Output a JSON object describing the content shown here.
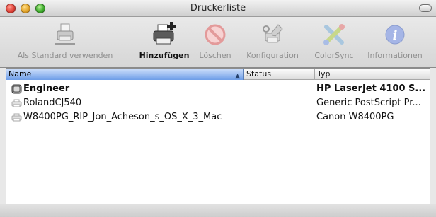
{
  "window": {
    "title": "Druckerliste"
  },
  "toolbar": {
    "items": [
      {
        "label": "Als Standard verwenden",
        "icon": "default-printer-icon",
        "enabled": false
      },
      {
        "label": "Hinzufügen",
        "icon": "add-printer-icon",
        "enabled": true
      },
      {
        "label": "Löschen",
        "icon": "delete-icon",
        "enabled": false
      },
      {
        "label": "Konfiguration",
        "icon": "configuration-icon",
        "enabled": false
      },
      {
        "label": "ColorSync",
        "icon": "colorsync-icon",
        "enabled": false
      },
      {
        "label": "Informationen",
        "icon": "info-icon",
        "enabled": false
      }
    ]
  },
  "list": {
    "columns": {
      "name": "Name",
      "status": "Status",
      "typ": "Typ"
    },
    "sort_indicator": "▲",
    "rows": [
      {
        "name": "Engineer",
        "status": "",
        "typ": "HP LaserJet 4100 S...",
        "default": true
      },
      {
        "name": "RolandCJ540",
        "status": "",
        "typ": "Generic PostScript Pr...",
        "default": false
      },
      {
        "name": "W8400PG_RIP_Jon_Acheson_s_OS_X_3_Mac",
        "status": "",
        "typ": "Canon W8400PG",
        "default": false
      }
    ]
  },
  "colors": {
    "header_selected": "#6e9ee8",
    "disabled_text": "#8f8f8f"
  }
}
